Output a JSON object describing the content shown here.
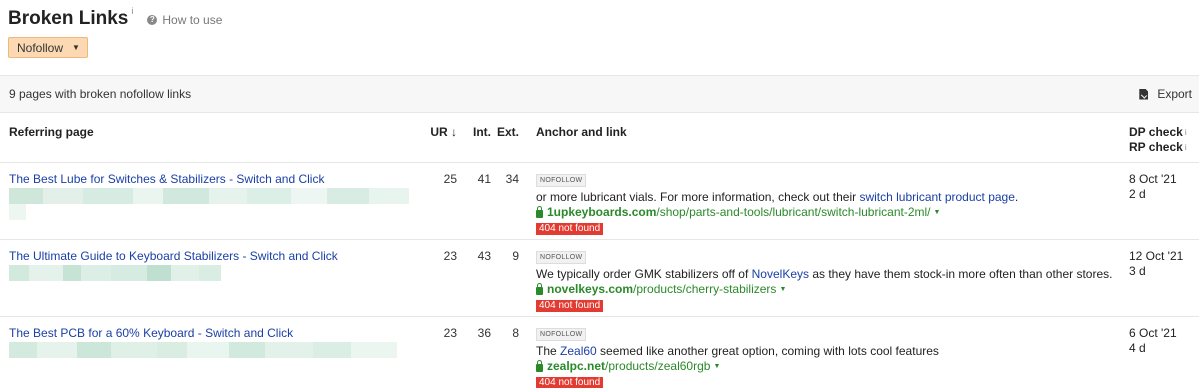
{
  "header": {
    "title": "Broken Links",
    "title_info": "i",
    "howto_icon": "?",
    "howto_label": "How to use"
  },
  "filter": {
    "label": "Nofollow",
    "caret": "▼",
    "color": "#fcd9b2"
  },
  "summary": {
    "text": "9 pages with broken nofollow links",
    "export_label": "Export"
  },
  "table": {
    "columns": {
      "referring_page": "Referring page",
      "ur": "UR",
      "ur_sort": "↓",
      "int": "Int.",
      "ext": "Ext.",
      "anchor": "Anchor and link",
      "dp_check": "DP check",
      "rp_check": "RP check",
      "info": "i"
    },
    "rows": [
      {
        "title": "The Best Lube for Switches & Stabilizers - Switch and Click",
        "ur": "25",
        "int": "41",
        "ext": "34",
        "tag": "NOFOLLOW",
        "anchor_before": "or more lubricant vials. For more information, check out their ",
        "anchor_link": "switch lubricant product page",
        "anchor_after": ".",
        "url_domain": "1upkeyboards.com",
        "url_path": "/shop/parts-and-tools/lubricant/switch-lubricant-2ml/",
        "status": "404 not found",
        "dp_date": "8 Oct '21",
        "rp_check": "2 d"
      },
      {
        "title": "The Ultimate Guide to Keyboard Stabilizers - Switch and Click",
        "ur": "23",
        "int": "43",
        "ext": "9",
        "tag": "NOFOLLOW",
        "anchor_before": "We typically order GMK stabilizers off of ",
        "anchor_link": "NovelKeys",
        "anchor_after": " as they have them stock-in more often than other stores.",
        "url_domain": "novelkeys.com",
        "url_path": "/products/cherry-stabilizers",
        "status": "404 not found",
        "dp_date": "12 Oct '21",
        "rp_check": "3 d"
      },
      {
        "title": "The Best PCB for a 60% Keyboard - Switch and Click",
        "ur": "23",
        "int": "36",
        "ext": "8",
        "tag": "NOFOLLOW",
        "anchor_before": "The ",
        "anchor_link": "Zeal60",
        "anchor_after": " seemed like another great option, coming with lots cool features",
        "url_domain": "zealpc.net",
        "url_path": "/products/zeal60rgb",
        "status": "404 not found",
        "dp_date": "6 Oct '21",
        "rp_check": "4 d"
      }
    ]
  },
  "colors": {
    "link": "#1a3fa6",
    "url_green": "#2a8a2a",
    "status_red": "#e23b32"
  }
}
